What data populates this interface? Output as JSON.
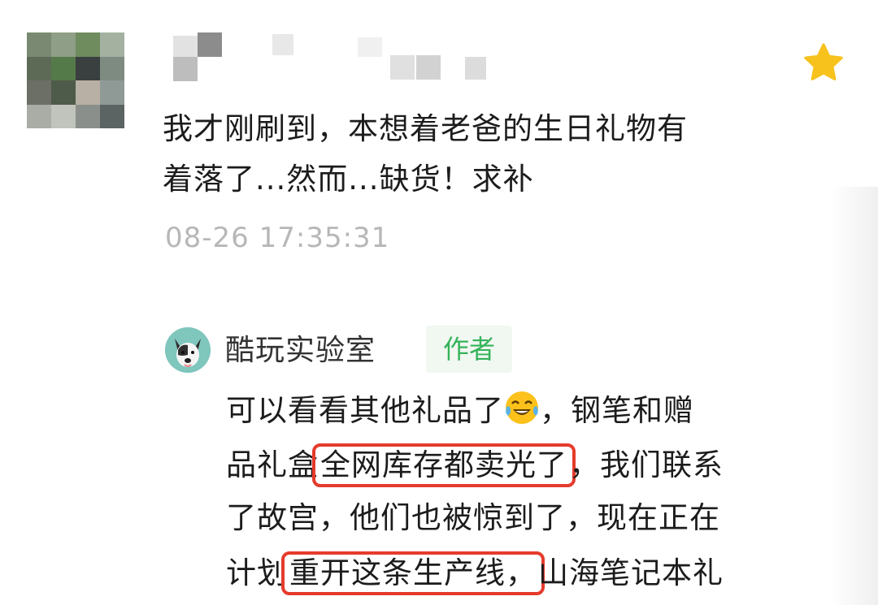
{
  "comment": {
    "text_line1": "我才刚刷到，本想着老爸的生日礼物有",
    "text_line2": "着落了...然而...缺货！求补",
    "timestamp": "08-26 17:35:31",
    "starred": true,
    "avatar_pixel_colors": [
      "#7a8a72",
      "#8f9e86",
      "#6f8c5e",
      "#a4b1a0",
      "#5d6b56",
      "#557a49",
      "#3a3f3f",
      "#7d8b80",
      "#6b6f66",
      "#4e5b4a",
      "#b8b0a5",
      "#8f9a96",
      "#a9ada5",
      "#c1c4bc",
      "#8a8f8b",
      "#5b6462"
    ],
    "icons": {
      "favorite": "star-icon"
    }
  },
  "reply": {
    "name": "酷玩实验室",
    "badge": "作者",
    "avatar_icon": "dog-avatar-icon",
    "line1_a": "可以看看其他礼品了",
    "emoji": "laughing-crying-emoji",
    "line1_b": "，钢笔和赠",
    "line2_a": "品礼盒",
    "line2_hl": "全网库存都卖光了",
    "line2_b": "，我们联系",
    "line3": "了故宫，他们也被惊到了，现在正在",
    "line4_a": "计划",
    "line4_hl": "重开这条生产线，",
    "line4_b": "山海笔记本礼"
  },
  "colors": {
    "highlight_box": "#e53b2c",
    "author_badge_text": "#35b35a",
    "timestamp": "#b7b7b7",
    "star": "#f7c21c"
  }
}
